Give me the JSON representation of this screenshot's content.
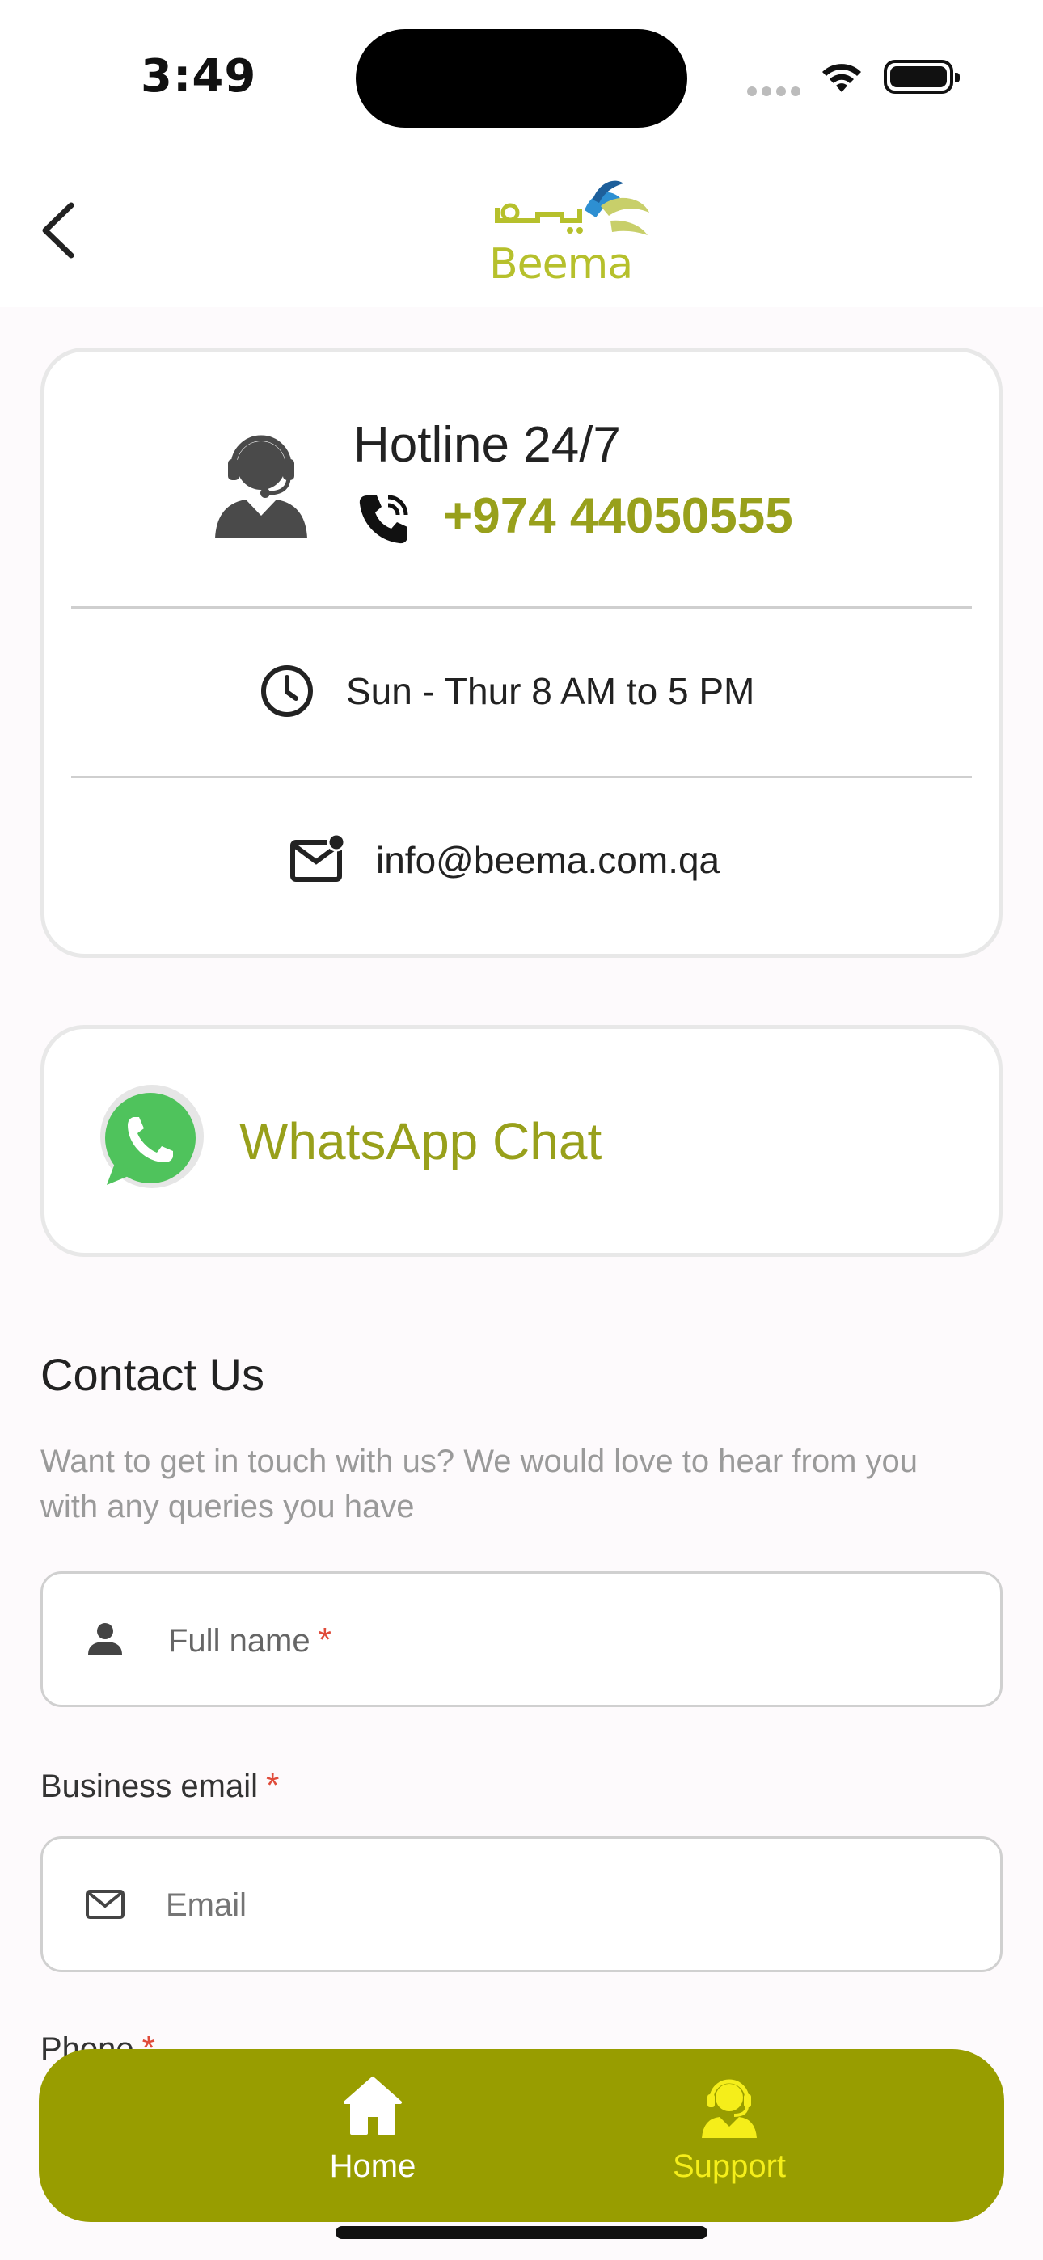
{
  "status_bar": {
    "time": "3:49"
  },
  "header": {
    "logo_text": "Beema"
  },
  "hotline_card": {
    "title": "Hotline 24/7",
    "number": "+974 44050555",
    "hours": "Sun - Thur 8 AM to 5 PM",
    "email": "info@beema.com.qa"
  },
  "whatsapp": {
    "label": "WhatsApp Chat"
  },
  "contact": {
    "title": "Contact Us",
    "description": "Want to get in touch with us? We would love to hear from you with any queries you have",
    "full_name_placeholder": "Full name",
    "required_mark": "*",
    "business_email_label": "Business email",
    "email_placeholder": "Email",
    "phone_label": "Phone"
  },
  "tab_bar": {
    "home_label": "Home",
    "support_label": "Support"
  },
  "colors": {
    "brand_olive": "#989d00",
    "accent_yellow": "#f5ee1a",
    "required_red": "#e04b3a"
  }
}
